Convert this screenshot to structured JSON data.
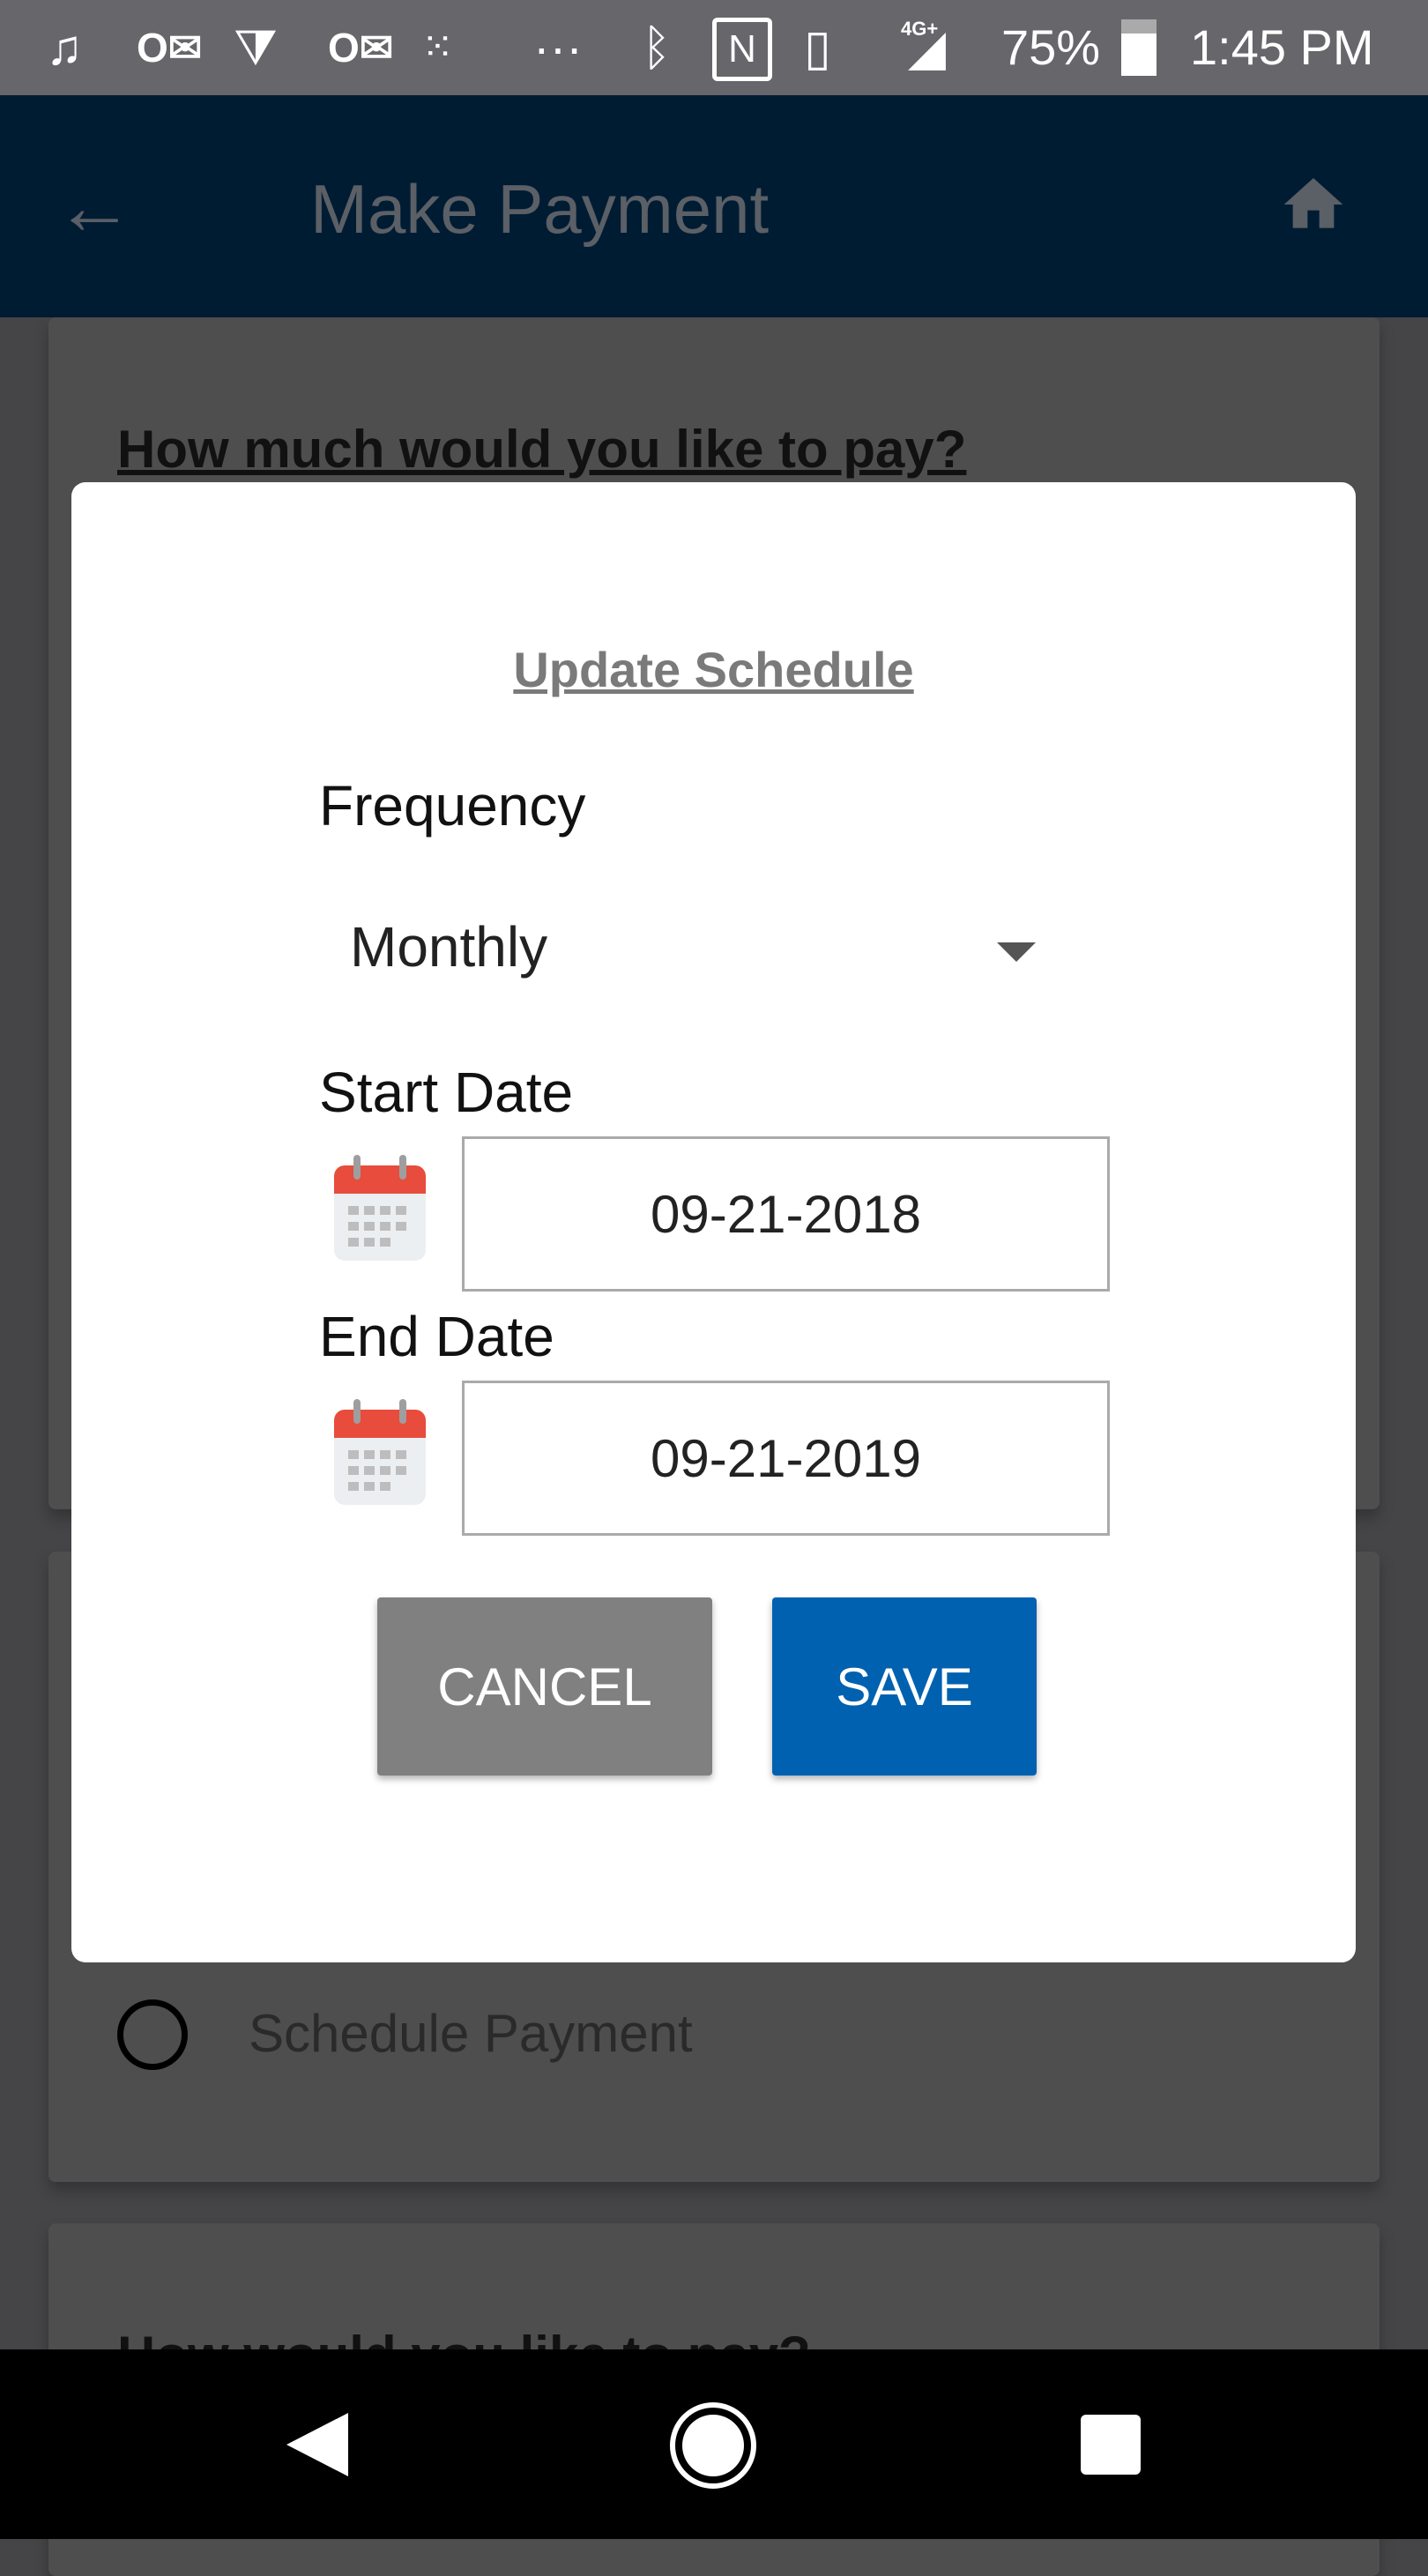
{
  "status_bar": {
    "battery": "75%",
    "time": "1:45 PM",
    "network": "4G+",
    "icons": [
      "music-note-icon",
      "outlook-icon",
      "jira-icon",
      "outlook-icon",
      "fitbit-icon",
      "more-icon",
      "bluetooth-icon",
      "nfc-icon",
      "vibrate-icon",
      "signal-icon",
      "battery-icon"
    ]
  },
  "app_bar": {
    "title": "Make Payment",
    "back_icon": "arrow-left-icon",
    "home_icon": "home-icon"
  },
  "background": {
    "card1_heading": "How much would you like to pay?",
    "schedule_option": "Schedule Payment",
    "card3_heading": "How would you like to pay?"
  },
  "modal": {
    "title": "Update Schedule",
    "frequency_label": "Frequency",
    "frequency_value": "Monthly",
    "start_label": "Start Date",
    "start_value": "09-21-2018",
    "end_label": "End Date",
    "end_value": "09-21-2019",
    "cancel_label": "CANCEL",
    "save_label": "SAVE"
  },
  "colors": {
    "app_bar": "#001c33",
    "save": "#0061b0",
    "cancel": "#808080",
    "calendar": "#e74c3c"
  }
}
